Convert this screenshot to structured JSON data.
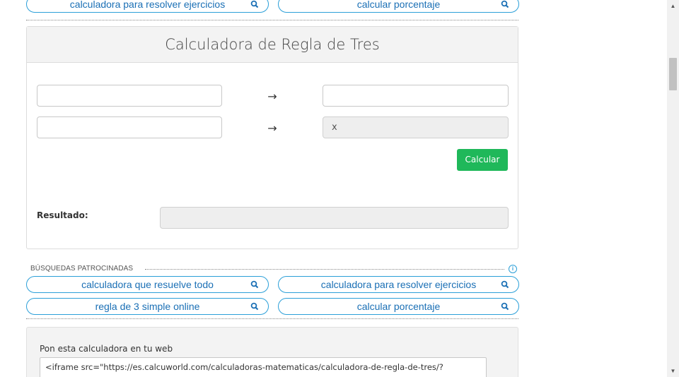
{
  "sponsored_top": {
    "left_pill": "calculadora para resolver ejercicios",
    "right_pill": "calcular porcentaje"
  },
  "calculator": {
    "title": "Calculadora de Regla de Tres",
    "row1": {
      "a_value": "",
      "arrow": "→",
      "b_value": ""
    },
    "row2": {
      "c_value": "",
      "arrow": "→",
      "x_value": "x"
    },
    "calc_button": "Calcular",
    "result_label": "Resultado:",
    "result_value": ""
  },
  "sponsored": {
    "heading": "BÚSQUEDAS PATROCINADAS",
    "info_icon": "i",
    "pills": [
      "calculadora que resuelve todo",
      "calculadora para resolver ejercicios",
      "regla de 3 simple online",
      "calcular porcentaje"
    ]
  },
  "embed": {
    "title": "Pon esta calculadora en tu web",
    "code": "<iframe src=\"https://es.calcuworld.com/calculadoras-matematicas/calculadora-de-regla-de-tres/?"
  },
  "icons": {
    "search": "magnifier-icon",
    "scroll_up": "▲",
    "scroll_down": "▼"
  },
  "colors": {
    "pill_border": "#2b9fd8",
    "pill_text": "#1a6fb5",
    "calc_button": "#1fb85a",
    "header_bg": "#f3f3f3"
  }
}
